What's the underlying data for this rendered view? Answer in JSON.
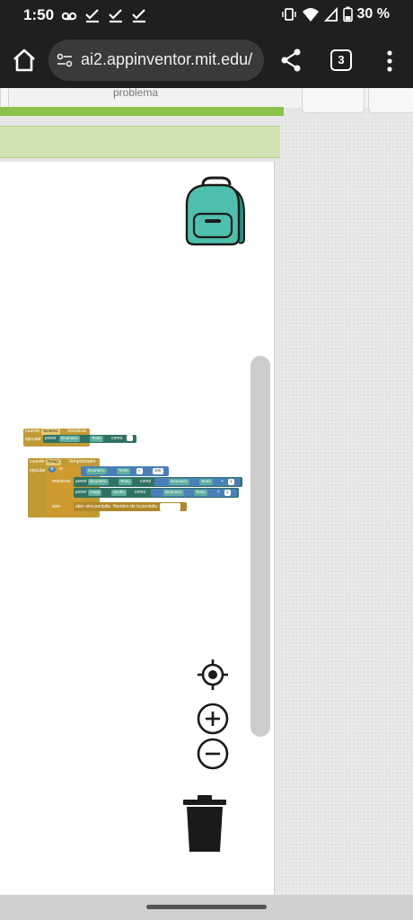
{
  "status_bar": {
    "time": "1:50",
    "battery": "30 %",
    "icons_left": [
      "voicemail-icon",
      "check-icon",
      "check-icon",
      "check-icon"
    ],
    "icons_right": [
      "vibrate-icon",
      "wifi-icon",
      "signal-icon",
      "battery-icon"
    ]
  },
  "browser": {
    "url": "ai2.appinventor.mit.edu/",
    "tab_count": "3"
  },
  "page": {
    "tab_label": "problema",
    "accent_green": "#8bc34a",
    "band_green": "#cfe4b2"
  },
  "blocks": {
    "init_event": {
      "when": "cuando",
      "component": "Screen1",
      "event": ".Inicializar",
      "do": "ejecutar",
      "set": "poner",
      "var": "lvnumero",
      "prop": "Texto",
      "as": "como",
      "value": "0"
    },
    "timer_event": {
      "when": "cuando",
      "component": "Reloj1",
      "event": ".Temporizador",
      "do": "ejecutar",
      "if": "si",
      "then": "entonces",
      "else": "sino",
      "cond_var": "lvnumero",
      "cond_prop": "Texto",
      "op": "<",
      "limit": "100",
      "set1": "poner",
      "set1_var": "lvnumero",
      "set1_prop": "Texto",
      "set1_as": "como",
      "add_var": "lvnumero",
      "add_prop": "Texto",
      "plus": "+",
      "add_val": "1",
      "set2": "poner",
      "set2_var": "carga",
      "set2_prop": "Ancho",
      "set2_as": "como",
      "mul_var": "lvnumero",
      "mul_prop": "Texto",
      "times": "×",
      "mul_val": "2",
      "open": "abrir otra pantalla",
      "screen_label": "Nombre de la pantalla",
      "screen_val": "Screen2"
    }
  }
}
